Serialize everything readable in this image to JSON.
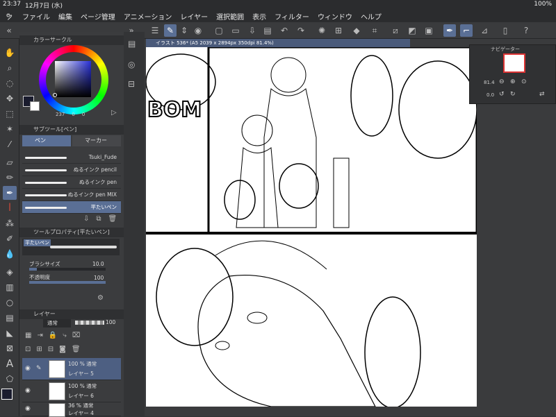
{
  "status": {
    "time": "23:37",
    "date": "12月7日 (水)",
    "battery": "100%"
  },
  "menu": [
    "ファイル",
    "編集",
    "ページ管理",
    "アニメーション",
    "レイヤー",
    "選択範囲",
    "表示",
    "フィルター",
    "ウィンドウ",
    "ヘルプ"
  ],
  "palettes": {
    "color_circle_title": "カラーサークル",
    "color_values": {
      "h": "237",
      "s": "0",
      "v": "0"
    },
    "subtool_title": "サブツール[ペン]",
    "subtool_tabs": [
      "ペン",
      "マーカー"
    ],
    "brushes": [
      "Tsuki_Fude",
      "ぬるインク pencil",
      "ぬるインク pen",
      "ぬるインク pen MIX",
      "平たいペン"
    ],
    "toolprop_title": "ツールプロパティ[平たいペン]",
    "toolprop_name": "平たいペン",
    "brush_size_label": "ブラシサイズ",
    "brush_size_value": "10.0",
    "opacity_label": "不透明度",
    "opacity_value": "100",
    "layer_title": "レイヤー",
    "blend_mode": "通常",
    "layer_opacity": "100",
    "layers": [
      {
        "pct": "100 %  通常",
        "name": "レイヤー 5"
      },
      {
        "pct": "100 %  通常",
        "name": "レイヤー 6"
      },
      {
        "pct": "36 %  通常",
        "name": "レイヤー 4"
      }
    ]
  },
  "canvas": {
    "tab_title": "イラスト 536* (A5 2039 x 2894px 350dpi 81.4%)",
    "sfx_text": "BOM"
  },
  "navigator": {
    "title": "ナビゲーター",
    "zoom": "81.4",
    "rotation": "0.0"
  },
  "colors": {
    "accent": "#5a6f95",
    "panel": "#3b3c3e",
    "main_color": "#1a1c2e"
  }
}
